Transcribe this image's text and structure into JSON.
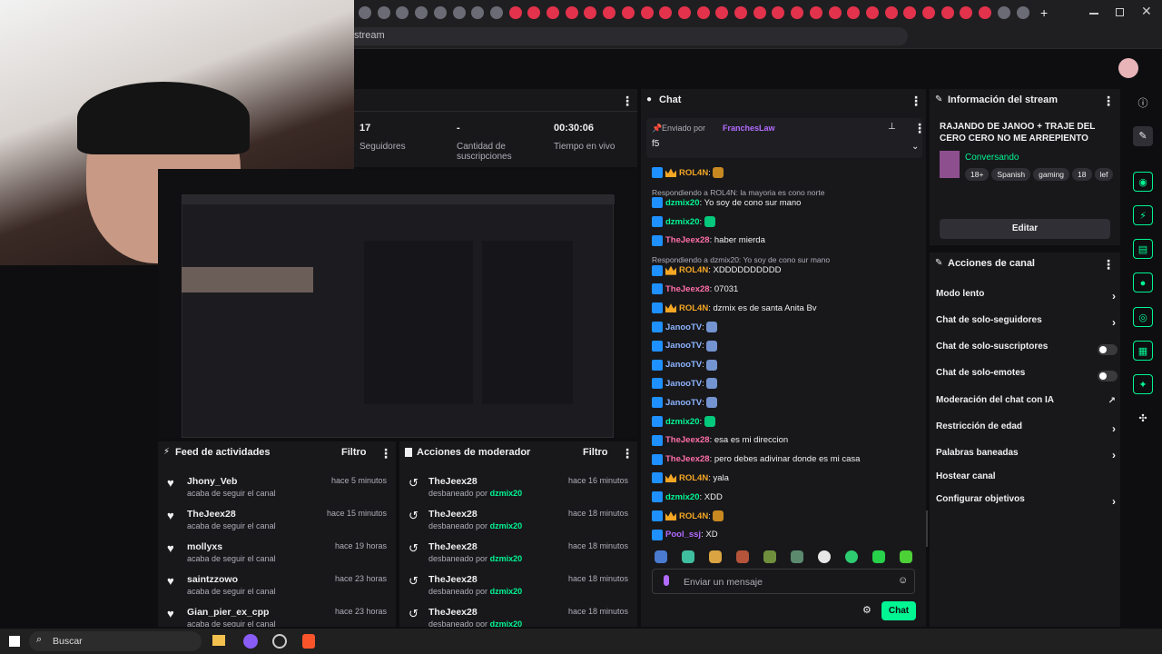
{
  "browser": {
    "url": "stream",
    "tab_icons": 36,
    "new_tab": "+"
  },
  "stats": {
    "followers_value": "17",
    "followers_label": "Seguidores",
    "subs_value": "-",
    "subs_label": "Cantidad de suscripciones",
    "live_value": "00:30:06",
    "live_label": "Tiempo en vivo"
  },
  "activity_feed": {
    "title": "Feed de actividades",
    "filter": "Filtro",
    "items": [
      {
        "name": "Jhony_Veb",
        "time": "hace 5 minutos",
        "action": "acaba de seguir el canal"
      },
      {
        "name": "TheJeex28",
        "time": "hace 15 minutos",
        "action": "acaba de seguir el canal"
      },
      {
        "name": "mollyxs",
        "time": "hace 19 horas",
        "action": "acaba de seguir el canal"
      },
      {
        "name": "saintzzowo",
        "time": "hace 23 horas",
        "action": "acaba de seguir el canal"
      },
      {
        "name": "Gian_pier_ex_cpp",
        "time": "hace 23 horas",
        "action": "acaba de seguir el canal"
      }
    ]
  },
  "mod_actions": {
    "title": "Acciones de moderador",
    "filter": "Filtro",
    "items": [
      {
        "name": "TheJeex28",
        "time": "hace 16 minutos",
        "action": "desbaneado por",
        "by": "dzmix20"
      },
      {
        "name": "TheJeex28",
        "time": "hace 18 minutos",
        "action": "desbaneado por",
        "by": "dzmix20"
      },
      {
        "name": "TheJeex28",
        "time": "hace 18 minutos",
        "action": "desbaneado por",
        "by": "dzmix20"
      },
      {
        "name": "TheJeex28",
        "time": "hace 18 minutos",
        "action": "desbaneado por",
        "by": "dzmix20"
      },
      {
        "name": "TheJeex28",
        "time": "hace 18 minutos",
        "action": "desbaneado por",
        "by": "dzmix20"
      }
    ]
  },
  "chat": {
    "title": "Chat",
    "pinned_by_label": "Enviado por",
    "pinned_by": "FranchesLaw",
    "pinned_text": "f5",
    "input_placeholder": "Enviar un mensaje",
    "send_label": "Chat",
    "messages": [
      {
        "kind": "msg",
        "user": "ROL4N",
        "color": "#f5a623",
        "crown": true,
        "text": ""
      },
      {
        "kind": "reply",
        "text": "Respondiendo a ROL4N: la mayoria es cono norte"
      },
      {
        "kind": "msg",
        "user": "dzmix20",
        "color": "#00f593",
        "crown": false,
        "text": "Yo soy de cono sur mano"
      },
      {
        "kind": "msg",
        "user": "dzmix20",
        "color": "#00f593",
        "crown": false,
        "text": ""
      },
      {
        "kind": "msg",
        "user": "TheJeex28",
        "color": "#ff6ea8",
        "crown": false,
        "text": "haber mierda"
      },
      {
        "kind": "reply",
        "text": "Respondiendo a dzmix20: Yo soy de cono sur mano"
      },
      {
        "kind": "msg",
        "user": "ROL4N",
        "color": "#f5a623",
        "crown": true,
        "text": "XDDDDDDDDDD"
      },
      {
        "kind": "msg",
        "user": "TheJeex28",
        "color": "#ff6ea8",
        "crown": false,
        "text": "07031"
      },
      {
        "kind": "msg",
        "user": "ROL4N",
        "color": "#f5a623",
        "crown": true,
        "text": "dzmix es de santa Anita Bv"
      },
      {
        "kind": "msg",
        "user": "JanooTV",
        "color": "#8cb4ff",
        "crown": false,
        "text": ""
      },
      {
        "kind": "msg",
        "user": "JanooTV",
        "color": "#8cb4ff",
        "crown": false,
        "text": ""
      },
      {
        "kind": "msg",
        "user": "JanooTV",
        "color": "#8cb4ff",
        "crown": false,
        "text": ""
      },
      {
        "kind": "msg",
        "user": "JanooTV",
        "color": "#8cb4ff",
        "crown": false,
        "text": ""
      },
      {
        "kind": "msg",
        "user": "JanooTV",
        "color": "#8cb4ff",
        "crown": false,
        "text": ""
      },
      {
        "kind": "msg",
        "user": "dzmix20",
        "color": "#00f593",
        "crown": false,
        "text": ""
      },
      {
        "kind": "msg",
        "user": "TheJeex28",
        "color": "#ff6ea8",
        "crown": false,
        "text": "esa es mi direccion"
      },
      {
        "kind": "msg",
        "user": "TheJeex28",
        "color": "#ff6ea8",
        "crown": false,
        "text": "pero debes adivinar donde es mi casa"
      },
      {
        "kind": "msg",
        "user": "ROL4N",
        "color": "#f5a623",
        "crown": true,
        "text": "yala"
      },
      {
        "kind": "msg",
        "user": "dzmix20",
        "color": "#00f593",
        "crown": false,
        "text": "XDD"
      },
      {
        "kind": "msg",
        "user": "ROL4N",
        "color": "#f5a623",
        "crown": true,
        "text": ""
      },
      {
        "kind": "msg",
        "user": "Pool_ssj",
        "color": "#b36bff",
        "crown": false,
        "text": "XD"
      }
    ]
  },
  "stream_info": {
    "title": "Información del stream",
    "stream_title": "RAJANDO DE JANOO + TRAJE DEL CERO CERO NO ME ARREPIENTO",
    "category": "Conversando",
    "tags": [
      "18+",
      "Spanish",
      "gaming",
      "18",
      "lef"
    ],
    "edit_label": "Editar"
  },
  "channel_actions": {
    "title": "Acciones de canal",
    "items": [
      {
        "label": "Modo lento",
        "control": "chevron"
      },
      {
        "label": "Chat de solo-seguidores",
        "control": "chevron"
      },
      {
        "label": "Chat de solo-suscriptores",
        "control": "toggle"
      },
      {
        "label": "Chat de solo-emotes",
        "control": "toggle"
      },
      {
        "label": "Moderación del chat con IA",
        "control": "external"
      },
      {
        "label": "Restricción de edad",
        "control": "chevron"
      },
      {
        "label": "Palabras baneadas",
        "control": "chevron"
      },
      {
        "label": "Hostear canal",
        "control": "none"
      },
      {
        "label": "Configurar objetivos",
        "control": "chevron"
      }
    ]
  },
  "taskbar": {
    "search_label": "Buscar"
  },
  "colors": {
    "accent": "#00f593",
    "panel": "#18181b",
    "background": "#0e0e10"
  }
}
